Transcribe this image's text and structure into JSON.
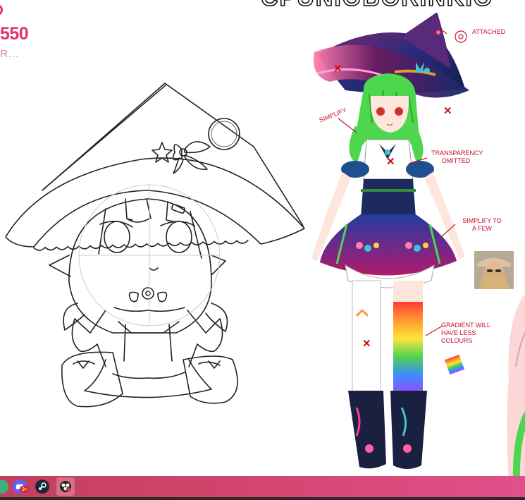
{
  "overlay": {
    "count": "550",
    "subtext": "R...",
    "title": "CPUNIOBORINKIO"
  },
  "annotations": {
    "attached": "Attached",
    "simplify": "Simplify",
    "transparency": "Transparency omitted",
    "simplify_few": "Simplify to a few",
    "gradient": "Gradient will have less colours"
  },
  "taskbar": {
    "icons": [
      "app-icon",
      "discord-icon",
      "steam-icon",
      "obs-icon"
    ],
    "discord_badge": "9+"
  },
  "colors": {
    "accent": "#e0356e",
    "annotation": "#c8102e",
    "taskbar": "#d2456e"
  }
}
